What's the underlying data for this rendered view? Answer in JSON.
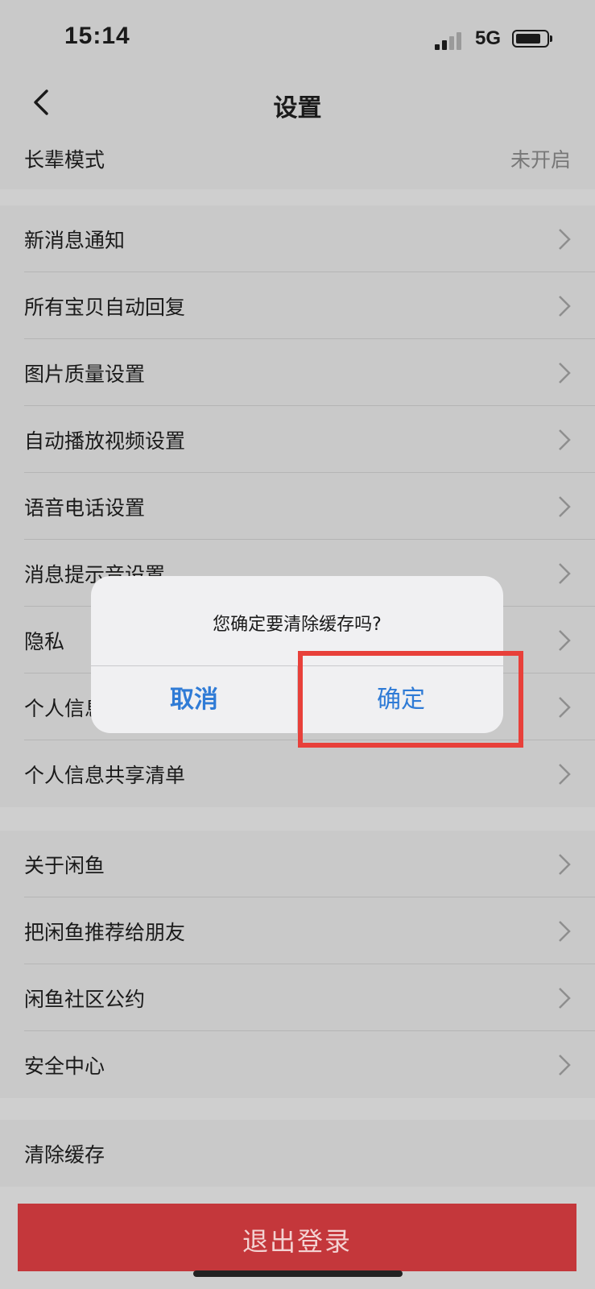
{
  "status_bar": {
    "time": "15:14",
    "network": "5G"
  },
  "nav": {
    "title": "设置"
  },
  "elder_mode": {
    "label": "长辈模式",
    "value": "未开启"
  },
  "group1": [
    {
      "label": "新消息通知"
    },
    {
      "label": "所有宝贝自动回复"
    },
    {
      "label": "图片质量设置"
    },
    {
      "label": "自动播放视频设置"
    },
    {
      "label": "语音电话设置"
    },
    {
      "label": "消息提示音设置"
    },
    {
      "label": "隐私"
    },
    {
      "label": "个人信息"
    },
    {
      "label": "个人信息共享清单"
    }
  ],
  "group2": [
    {
      "label": "关于闲鱼"
    },
    {
      "label": "把闲鱼推荐给朋友"
    },
    {
      "label": "闲鱼社区公约"
    },
    {
      "label": "安全中心"
    }
  ],
  "clear_cache": {
    "label": "清除缓存"
  },
  "logout": {
    "label": "退出登录"
  },
  "dialog": {
    "message": "您确定要清除缓存吗?",
    "cancel": "取消",
    "confirm": "确定"
  },
  "colors": {
    "accent": "#2f7bd6",
    "logout": "#c4373b",
    "highlight": "#e8403a"
  }
}
